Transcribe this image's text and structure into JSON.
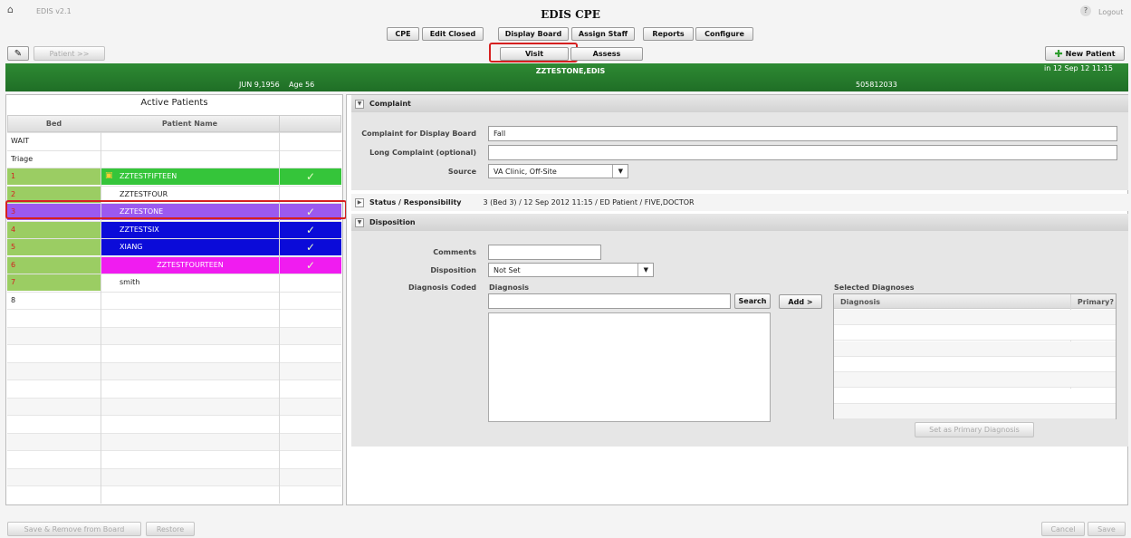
{
  "app": {
    "version": "EDIS v2.1",
    "title": "EDIS CPE",
    "logout": "Logout",
    "help": "?"
  },
  "top_nav": [
    "CPE",
    "Edit Closed",
    "Display Board",
    "Assign Staff",
    "Reports",
    "Configure"
  ],
  "toolbar": {
    "patient_btn": "Patient >>",
    "new_patient": "New Patient",
    "tabs": [
      "Visit",
      "Assess"
    ]
  },
  "patient_banner": {
    "name": "ZZTESTONE,EDIS",
    "time": "in 12 Sep 12 11:15",
    "dob": "JUN 9,1956",
    "age": "Age 56",
    "id": "505812033"
  },
  "active_patients": {
    "title": "Active Patients",
    "col_bed": "Bed",
    "col_name": "Patient Name",
    "rows": [
      {
        "bed": "WAIT",
        "name": "",
        "check": "",
        "color": "#ffffff",
        "bedcolor": "#ffffff",
        "textcolor": "#222"
      },
      {
        "bed": "Triage",
        "name": "",
        "check": "",
        "color": "#ffffff",
        "bedcolor": "#ffffff",
        "textcolor": "#222"
      },
      {
        "bed": "1",
        "name": "ZZTESTFIFTEEN",
        "check": "✓",
        "color": "#35c53a",
        "bedcolor": "#9bcd63",
        "textcolor": "#ffffff"
      },
      {
        "bed": "2",
        "name": "ZZTESTFOUR",
        "check": "",
        "color": "#ffffff",
        "bedcolor": "#9bcd63",
        "textcolor": "#222"
      },
      {
        "bed": "3",
        "name": "ZZTESTONE",
        "check": "✓",
        "color": "#9b59f0",
        "bedcolor": "#9b59f0",
        "textcolor": "#ffffff"
      },
      {
        "bed": "4",
        "name": "ZZTESTSIX",
        "check": "✓",
        "color": "#0b0bd9",
        "bedcolor": "#9bcd63",
        "textcolor": "#ffffff"
      },
      {
        "bed": "5",
        "name": "XIANG",
        "check": "✓",
        "color": "#0b0bd9",
        "bedcolor": "#9bcd63",
        "textcolor": "#ffffff"
      },
      {
        "bed": "6",
        "name": "ZZTESTFOURTEEN",
        "check": "✓",
        "color": "#f01cf0",
        "bedcolor": "#9bcd63",
        "textcolor": "#ffffff"
      },
      {
        "bed": "7",
        "name": "smith",
        "check": "",
        "color": "#ffffff",
        "bedcolor": "#9bcd63",
        "textcolor": "#222"
      },
      {
        "bed": "8",
        "name": "",
        "check": "",
        "color": "#ffffff",
        "bedcolor": "#ffffff",
        "textcolor": "#222"
      }
    ]
  },
  "complaint": {
    "header": "Complaint",
    "display_label": "Complaint for Display Board",
    "display_value": "Fall",
    "long_label": "Long Complaint (optional)",
    "long_value": "",
    "source_label": "Source",
    "source_value": "VA Clinic, Off-Site"
  },
  "status": {
    "header": "Status / Responsibility",
    "value": "3 (Bed 3) / 12 Sep 2012 11:15 / ED Patient / FIVE,DOCTOR"
  },
  "disposition": {
    "header": "Disposition",
    "comments_label": "Comments",
    "comments_value": "",
    "disp_label": "Disposition",
    "disp_value": "Not Set",
    "dx_coded_label": "Diagnosis Coded",
    "dx_label": "Diagnosis",
    "search_btn": "Search",
    "add_btn": "Add >",
    "selected_label": "Selected Diagnoses",
    "col_dx": "Diagnosis",
    "col_primary": "Primary?",
    "set_primary_btn": "Set as Primary Diagnosis"
  },
  "footer": {
    "save_remove": "Save & Remove from Board",
    "restore": "Restore",
    "cancel": "Cancel",
    "save": "Save"
  }
}
